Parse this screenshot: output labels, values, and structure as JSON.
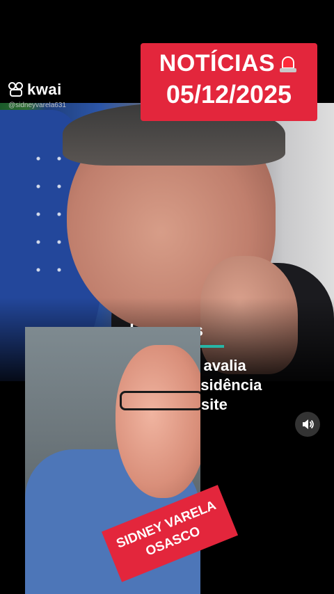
{
  "app": {
    "name": "kwai",
    "handle": "@sidneyvarela631"
  },
  "badge": {
    "title": "NOTÍCIAS",
    "date": "05/12/2025",
    "icon": "siren-icon"
  },
  "article": {
    "source": "plenonews",
    "headline_lines": [
      "Joesley Batista avalia",
      "candidatura à Presidência",
      "em 2026, diz site"
    ]
  },
  "presenter_tag": {
    "line1": "SIDNEY VARELA",
    "line2": "OSASCO"
  },
  "controls": {
    "sound_icon": "speaker-icon"
  },
  "colors": {
    "badge": "#e3263c",
    "source_accent": "#27b6a6"
  }
}
